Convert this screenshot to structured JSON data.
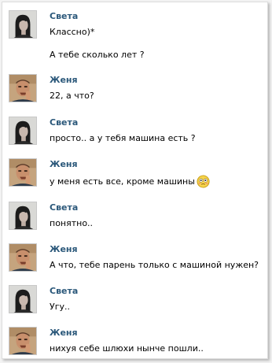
{
  "messages": [
    {
      "sender": "Света",
      "avatar": "sveta-avatar",
      "lines": [
        "Классно)*",
        "А тебе сколько лет ?"
      ]
    },
    {
      "sender": "Женя",
      "avatar": "zhenya-avatar",
      "lines": [
        "22, а что?"
      ]
    },
    {
      "sender": "Света",
      "avatar": "sveta-avatar",
      "lines": [
        "просто.. а у тебя машина есть ?"
      ]
    },
    {
      "sender": "Женя",
      "avatar": "zhenya-avatar",
      "lines": [
        "у меня есть все, кроме машины"
      ],
      "emoji": "embarrassed-smiley-icon"
    },
    {
      "sender": "Света",
      "avatar": "sveta-avatar",
      "lines": [
        "понятно.."
      ]
    },
    {
      "sender": "Женя",
      "avatar": "zhenya-avatar",
      "lines": [
        "А что, тебе парень только с машиной нужен?"
      ]
    },
    {
      "sender": "Света",
      "avatar": "sveta-avatar",
      "lines": [
        "Угу.."
      ]
    },
    {
      "sender": "Женя",
      "avatar": "zhenya-avatar",
      "lines": [
        "нихуя себе шлюхи нынче пошли.."
      ]
    }
  ],
  "colors": {
    "sender_name": "#2b587a",
    "text": "#000000",
    "background": "#ffffff"
  }
}
